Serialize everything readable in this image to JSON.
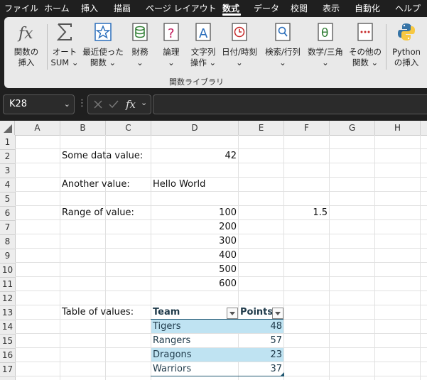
{
  "menu": [
    {
      "label": "ファイル"
    },
    {
      "label": "ホーム"
    },
    {
      "label": "挿入"
    },
    {
      "label": "描画"
    },
    {
      "label": "ページ レイアウト"
    },
    {
      "label": "数式"
    },
    {
      "label": "データ"
    },
    {
      "label": "校閲"
    },
    {
      "label": "表示"
    },
    {
      "label": "自動化"
    },
    {
      "label": "ヘルプ"
    }
  ],
  "active_tab": "数式",
  "ribbon": {
    "group_label": "関数ライブラリ",
    "buttons": [
      {
        "line1": "関数の",
        "line2": "挿入",
        "icon": "fx-icon"
      },
      {
        "line1": "オート",
        "line2": "SUM ⌄",
        "icon": "sigma-icon"
      },
      {
        "line1": "最近使った",
        "line2": "関数 ⌄",
        "icon": "star-icon"
      },
      {
        "line1": "財務",
        "line2": "⌄",
        "icon": "database-icon"
      },
      {
        "line1": "論理",
        "line2": "⌄",
        "icon": "question-book-icon"
      },
      {
        "line1": "文字列",
        "line2": "操作 ⌄",
        "icon": "text-a-icon"
      },
      {
        "line1": "日付/時刻",
        "line2": "⌄",
        "icon": "clock-icon"
      },
      {
        "line1": "検索/行列",
        "line2": "⌄",
        "icon": "magnifier-book-icon"
      },
      {
        "line1": "数学/三角",
        "line2": "⌄",
        "icon": "theta-icon"
      },
      {
        "line1": "その他の",
        "line2": "関数 ⌄",
        "icon": "more-functions-icon"
      },
      {
        "line1": "Python",
        "line2": "の挿入",
        "icon": "python-icon"
      }
    ]
  },
  "formula_bar": {
    "name_box": "K28",
    "formula": ""
  },
  "columns": [
    "A",
    "B",
    "C",
    "D",
    "E",
    "F",
    "G",
    "H"
  ],
  "rows": [
    "1",
    "2",
    "3",
    "4",
    "5",
    "6",
    "7",
    "8",
    "9",
    "10",
    "11",
    "12",
    "13",
    "14",
    "15",
    "16",
    "17"
  ],
  "cells": {
    "B2": "Some data value:",
    "D2": "42",
    "B4": "Another value:",
    "D4": "Hello World",
    "B6": "Range of value:",
    "D6": "100",
    "F6": "1.5",
    "D7": "200",
    "D8": "300",
    "D9": "400",
    "D10": "500",
    "D11": "600",
    "B13": "Table of values:"
  },
  "table": {
    "headers": [
      "Team",
      "Points"
    ],
    "rows": [
      [
        "Tigers",
        "48"
      ],
      [
        "Rangers",
        "57"
      ],
      [
        "Dragons",
        "23"
      ],
      [
        "Warriors",
        "37"
      ]
    ],
    "band_color": "#bfe3f2",
    "header_line_color": "#1f5670"
  },
  "colors": {
    "accent": "#217346",
    "ribbon_bg": "#e9e9e9",
    "chrome_bg": "#1f1f1f"
  }
}
